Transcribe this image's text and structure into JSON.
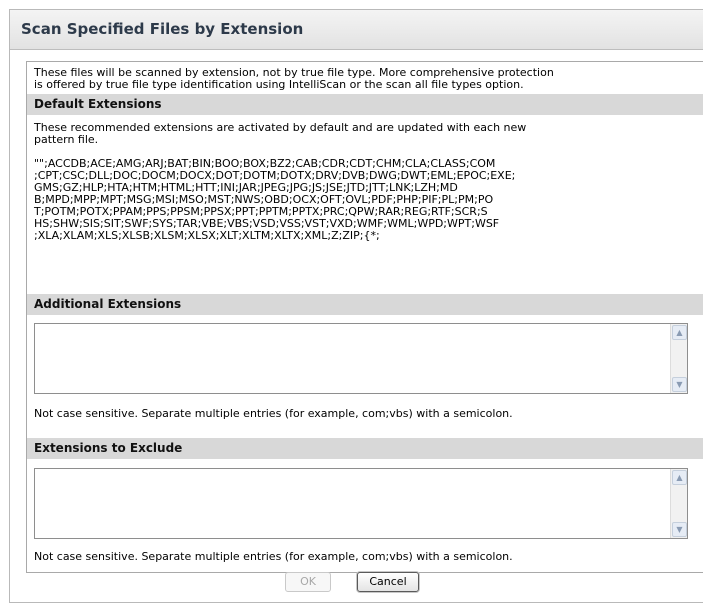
{
  "dialog": {
    "title": "Scan Specified Files by Extension",
    "intro_lines": [
      "These files will be scanned by extension, not by true file type. More comprehensive protection",
      "is offered by true file type identification using IntelliScan or the scan all file types option."
    ],
    "default_section": {
      "header": "Default Extensions",
      "description_lines": [
        "These recommended extensions are activated by default and are updated with each new",
        "pattern file."
      ],
      "extension_lines": [
        "\"\";ACCDB;ACE;AMG;ARJ;BAT;BIN;BOO;BOX;BZ2;CAB;CDR;CDT;CHM;CLA;CLASS;COM",
        ";CPT;CSC;DLL;DOC;DOCM;DOCX;DOT;DOTM;DOTX;DRV;DVB;DWG;DWT;EML;EPOC;EXE;",
        "GMS;GZ;HLP;HTA;HTM;HTML;HTT;INI;JAR;JPEG;JPG;JS;JSE;JTD;JTT;LNK;LZH;MD",
        "B;MPD;MPP;MPT;MSG;MSI;MSO;MST;NWS;OBD;OCX;OFT;OVL;PDF;PHP;PIF;PL;PM;PO",
        "T;POTM;POTX;PPAM;PPS;PPSM;PPSX;PPT;PPTM;PPTX;PRC;QPW;RAR;REG;RTF;SCR;S",
        "HS;SHW;SIS;SIT;SWF;SYS;TAR;VBE;VBS;VSD;VSS;VST;VXD;WMF;WML;WPD;WPT;WSF",
        ";XLA;XLAM;XLS;XLSB;XLSM;XLSX;XLT;XLTM;XLTX;XML;Z;ZIP;{*;"
      ]
    },
    "additional_section": {
      "header": "Additional Extensions",
      "value": "",
      "note": "Not case sensitive. Separate multiple entries (for example, com;vbs) with a semicolon."
    },
    "exclude_section": {
      "header": "Extensions to Exclude",
      "value": "",
      "note": "Not case sensitive. Separate multiple entries (for example, com;vbs) with a semicolon."
    },
    "buttons": {
      "ok": "OK",
      "ok_disabled": true,
      "cancel": "Cancel"
    }
  }
}
